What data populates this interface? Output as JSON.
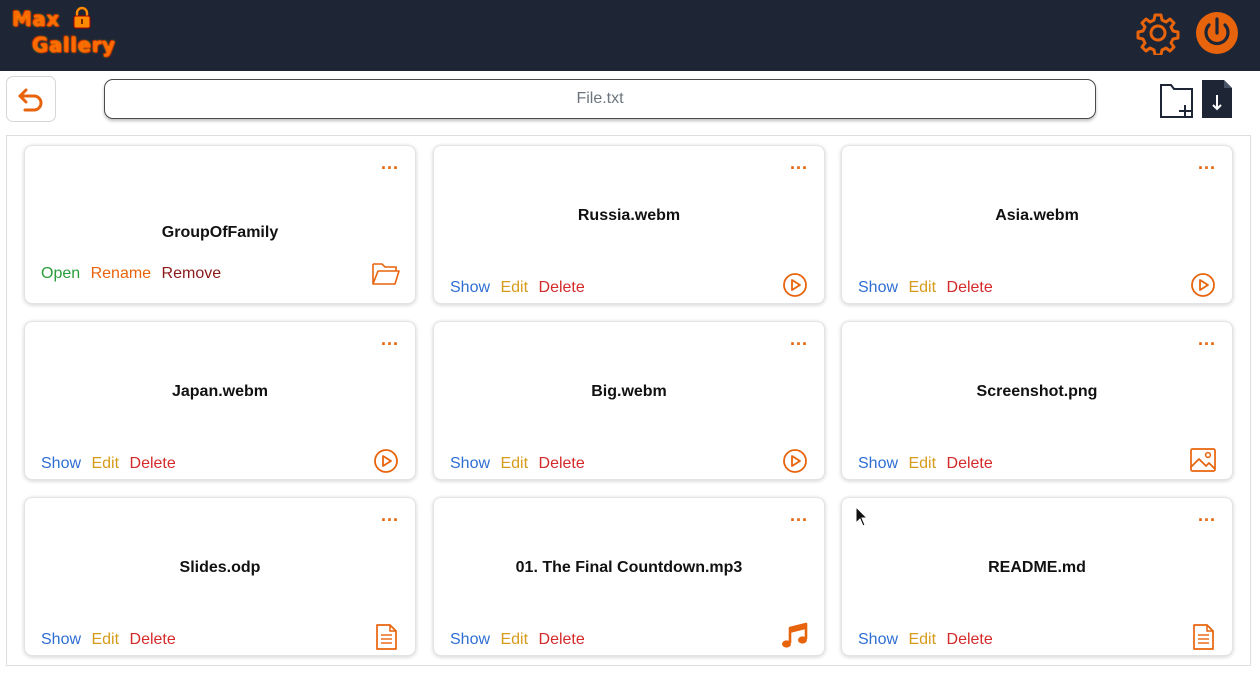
{
  "app": {
    "logo_line1": "Max",
    "logo_line2": "Gallery"
  },
  "toolbar": {
    "path_value": "File.txt"
  },
  "colors": {
    "accent": "#e8640c",
    "topbar": "#1e2535",
    "show": "#2f6ed3",
    "edit": "#d79b1b",
    "delete": "#d42a2a",
    "open": "#2a9d3a",
    "remove": "#8a1a1a"
  },
  "menu_label": "...",
  "cards": [
    {
      "title": "GroupOfFamily",
      "kind": "folder",
      "icon": "folder-open-icon",
      "actions": [
        "Open",
        "Rename",
        "Remove"
      ]
    },
    {
      "title": "Russia.webm",
      "kind": "video",
      "icon": "play-circle-icon",
      "actions": [
        "Show",
        "Edit",
        "Delete"
      ]
    },
    {
      "title": "Asia.webm",
      "kind": "video",
      "icon": "play-circle-icon",
      "actions": [
        "Show",
        "Edit",
        "Delete"
      ]
    },
    {
      "title": "Japan.webm",
      "kind": "video",
      "icon": "play-circle-icon",
      "actions": [
        "Show",
        "Edit",
        "Delete"
      ]
    },
    {
      "title": "Big.webm",
      "kind": "video",
      "icon": "play-circle-icon",
      "actions": [
        "Show",
        "Edit",
        "Delete"
      ]
    },
    {
      "title": "Screenshot.png",
      "kind": "image",
      "icon": "image-icon",
      "actions": [
        "Show",
        "Edit",
        "Delete"
      ]
    },
    {
      "title": "Slides.odp",
      "kind": "document",
      "icon": "document-icon",
      "actions": [
        "Show",
        "Edit",
        "Delete"
      ]
    },
    {
      "title": "01. The Final Countdown.mp3",
      "kind": "audio",
      "icon": "music-note-icon",
      "actions": [
        "Show",
        "Edit",
        "Delete"
      ]
    },
    {
      "title": "README.md",
      "kind": "document",
      "icon": "document-icon",
      "actions": [
        "Show",
        "Edit",
        "Delete"
      ]
    }
  ]
}
